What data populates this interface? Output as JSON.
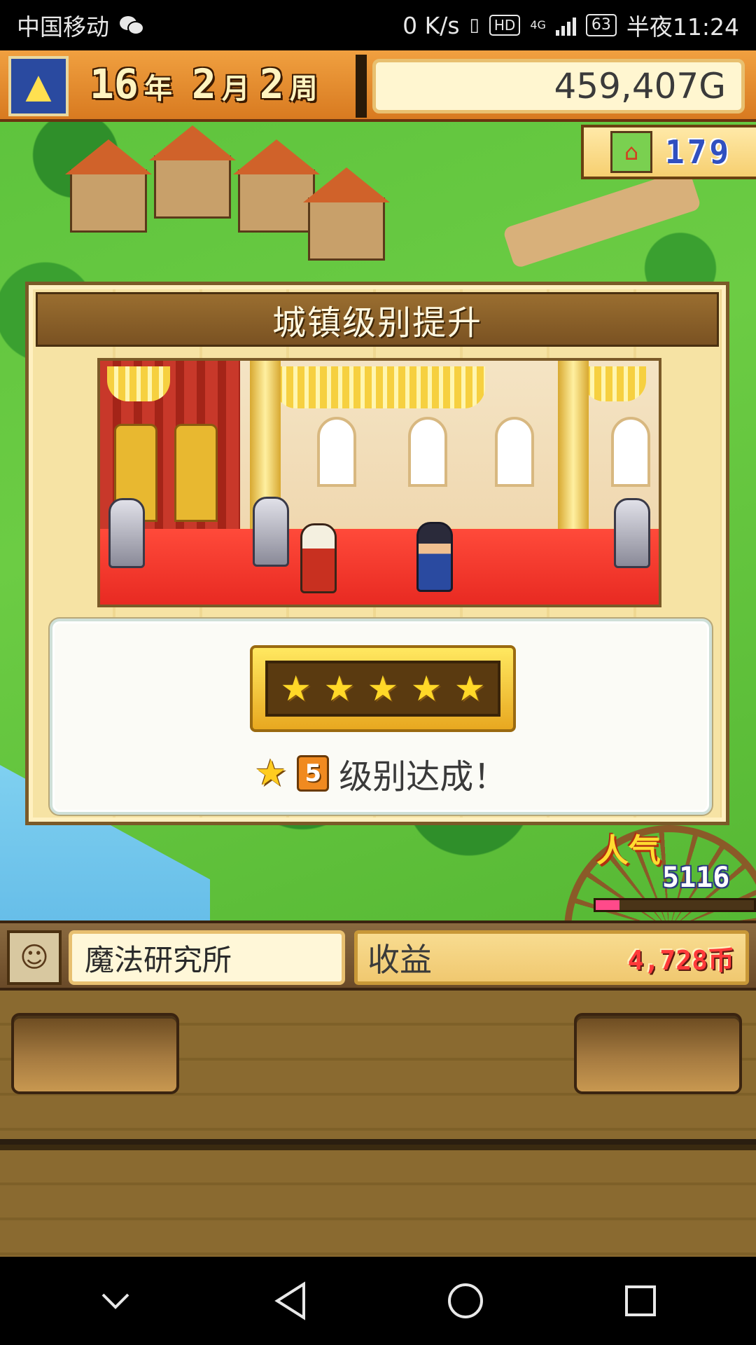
{
  "status_bar": {
    "carrier": "中国移动",
    "wechat_icon": "wechat-icon",
    "net_speed": "0 K/s",
    "hd_badge": "HD",
    "network_type": "4G",
    "battery": "63",
    "time": "半夜11:24"
  },
  "hud": {
    "year_num": "16",
    "year_unit": "年",
    "month_num": "2",
    "month_unit": "月",
    "week_num": "2",
    "week_unit": "周",
    "gold": "459,407G",
    "population": "179"
  },
  "dialog": {
    "title": "城镇级别提升",
    "stars": [
      "★",
      "★",
      "★",
      "★",
      "★"
    ],
    "level_number": "5",
    "level_text": "级别达成！"
  },
  "popularity": {
    "label": "人气",
    "value": "5116",
    "bar_fraction": 0.15
  },
  "info_bar": {
    "facility_name": "魔法研究所",
    "revenue_label": "收益",
    "revenue_value": "4,728币"
  },
  "colors": {
    "hud_orange": "#e88a2a",
    "wood": "#8a6a30",
    "carpet_red": "#ff4a3a",
    "star_gold": "#ffd828",
    "revenue_red": "#ff3a3a"
  }
}
